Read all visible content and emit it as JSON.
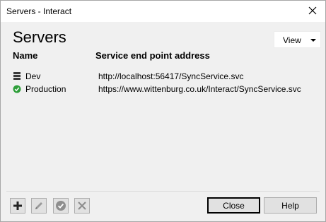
{
  "window": {
    "title": "Servers - Interact"
  },
  "header": {
    "title": "Servers",
    "view_label": "View"
  },
  "columns": {
    "name": "Name",
    "address": "Service end point address"
  },
  "servers": [
    {
      "name": "Dev",
      "address": "http://localhost:56417/SyncService.svc",
      "icon": "server-stack-icon"
    },
    {
      "name": "Production",
      "address": "https://www.wittenburg.co.uk/Interact/SyncService.svc",
      "icon": "check-circle-icon"
    }
  ],
  "toolbar": {
    "add": "add-icon",
    "edit": "pencil-icon",
    "activate": "check-icon",
    "delete": "delete-x-icon"
  },
  "buttons": {
    "close": "Close",
    "help": "Help"
  },
  "colors": {
    "client_bg": "#f0f0f0",
    "check_green": "#2e9e3a",
    "button_bg": "#e1e1e1"
  }
}
